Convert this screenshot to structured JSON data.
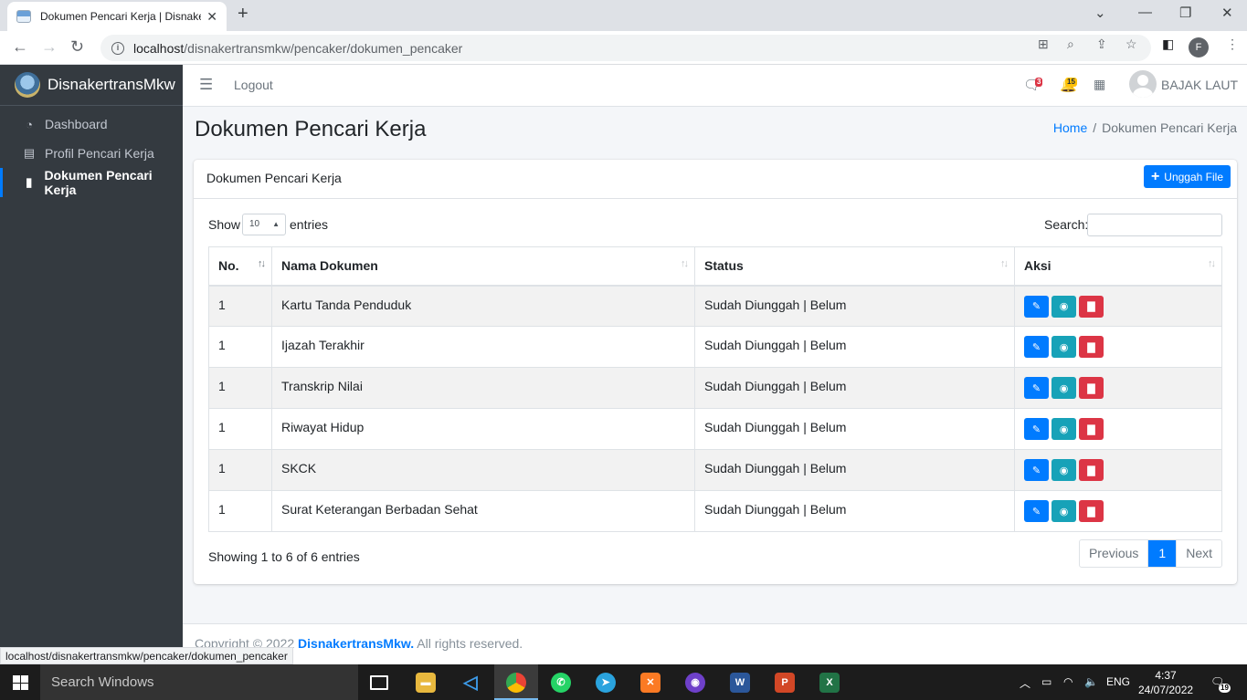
{
  "browser": {
    "tab_title": "Dokumen Pencari Kerja | Disnake",
    "url_host": "localhost",
    "url_path": "/disnakertransmkw/pencaker/dokumen_pencaker",
    "profile_initial": "F",
    "status_url": "localhost/disnakertransmkw/pencaker/dokumen_pencaker"
  },
  "sidebar": {
    "brand": "DisnakertransMkw",
    "items": [
      {
        "label": "Dashboard",
        "icon": "tachometer-icon"
      },
      {
        "label": "Profil Pencari Kerja",
        "icon": "id-card-icon"
      },
      {
        "label": "Dokumen Pencari Kerja",
        "icon": "file-icon",
        "active": true
      }
    ]
  },
  "navbar": {
    "logout": "Logout",
    "messages_count": "3",
    "notifications_count": "15",
    "user_name": "BAJAK LAUT"
  },
  "page": {
    "title": "Dokumen Pencari Kerja",
    "breadcrumb_home": "Home",
    "breadcrumb_sep": "/",
    "breadcrumb_current": "Dokumen Pencari Kerja"
  },
  "card": {
    "title": "Dokumen Pencari Kerja",
    "upload_label": "Unggah File",
    "show_label": "Show",
    "entries_value": "10",
    "entries_label": "entries",
    "search_label": "Search:",
    "columns": [
      "No.",
      "Nama Dokumen",
      "Status",
      "Aksi"
    ],
    "rows": [
      {
        "no": "1",
        "name": "Kartu Tanda Penduduk",
        "status": "Sudah Diunggah | Belum"
      },
      {
        "no": "1",
        "name": "Ijazah Terakhir",
        "status": "Sudah Diunggah | Belum"
      },
      {
        "no": "1",
        "name": "Transkrip Nilai",
        "status": "Sudah Diunggah | Belum"
      },
      {
        "no": "1",
        "name": "Riwayat Hidup",
        "status": "Sudah Diunggah | Belum"
      },
      {
        "no": "1",
        "name": "SKCK",
        "status": "Sudah Diunggah | Belum"
      },
      {
        "no": "1",
        "name": "Surat Keterangan Berbadan Sehat",
        "status": "Sudah Diunggah | Belum"
      }
    ],
    "showing": "Showing 1 to 6 of 6 entries",
    "pager": {
      "previous": "Previous",
      "current": "1",
      "next": "Next"
    }
  },
  "footer": {
    "prefix": "Copyright © 2022 ",
    "brand": "DisnakertransMkw.",
    "suffix": " All rights reserved."
  },
  "taskbar": {
    "search_placeholder": "Search Windows",
    "language": "ENG",
    "time": "4:37",
    "date": "24/07/2022",
    "notification_count": "19"
  },
  "colors": {
    "primary": "#007bff",
    "info": "#17a2b8",
    "danger": "#dc3545",
    "sidebar_bg": "#343a40"
  }
}
